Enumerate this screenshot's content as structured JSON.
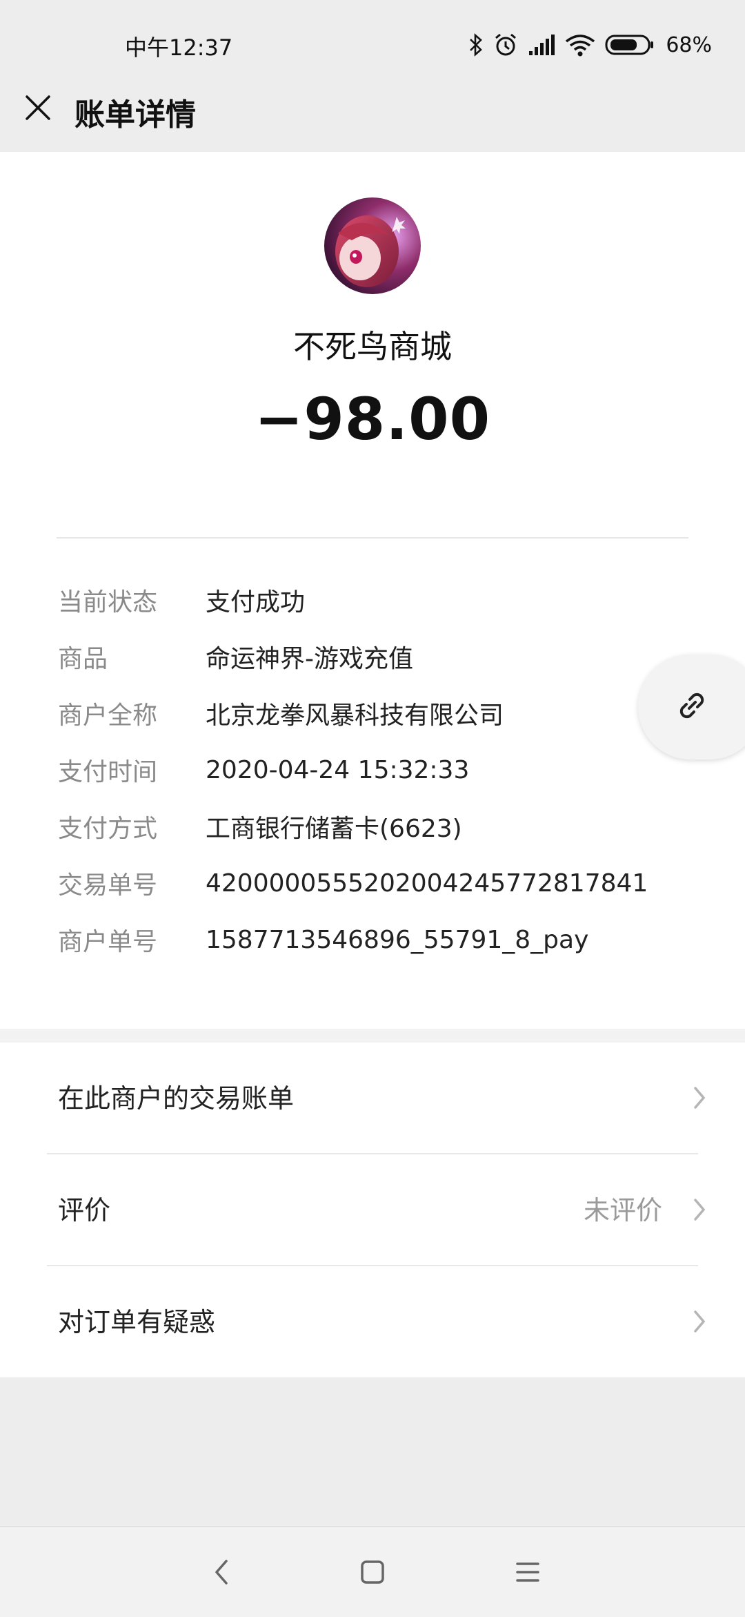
{
  "status": {
    "time": "中午12:37",
    "battery": "68%"
  },
  "header": {
    "title": "账单详情"
  },
  "merchant": {
    "name": "不死鸟商城",
    "amount": "−98.00"
  },
  "details": [
    {
      "label": "当前状态",
      "value": "支付成功"
    },
    {
      "label": "商品",
      "value": "命运神界-游戏充值"
    },
    {
      "label": "商户全称",
      "value": "北京龙拳风暴科技有限公司"
    },
    {
      "label": "支付时间",
      "value": "2020-04-24 15:32:33"
    },
    {
      "label": "支付方式",
      "value": "工商银行储蓄卡(6623)"
    },
    {
      "label": "交易单号",
      "value": "4200000555202004245772817841"
    },
    {
      "label": "商户单号",
      "value": "1587713546896_55791_8_pay"
    }
  ],
  "links": [
    {
      "label": "在此商户的交易账单",
      "extra": ""
    },
    {
      "label": "评价",
      "extra": "未评价"
    },
    {
      "label": "对订单有疑惑",
      "extra": ""
    }
  ],
  "icons": {
    "close": "close-icon",
    "link": "link-icon",
    "chevron": "chevron-right-icon",
    "nav_back": "back-icon",
    "nav_home": "home-icon",
    "nav_menu": "menu-icon"
  },
  "colors": {
    "background": "#ededed",
    "card": "#ffffff",
    "label": "#8a8a8a"
  }
}
